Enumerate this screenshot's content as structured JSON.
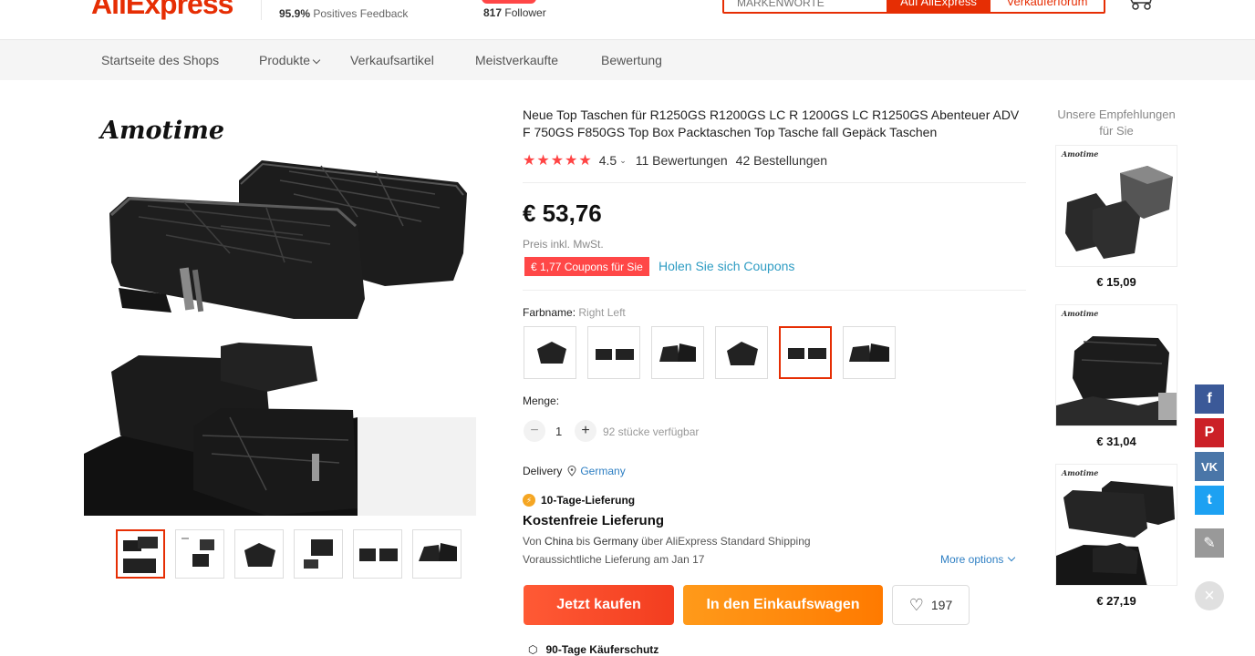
{
  "header": {
    "logo_text": "AliExpress",
    "feedback_percent": "95.9%",
    "feedback_label": "Positives Feedback",
    "followers_count": "817",
    "followers_label": "Follower",
    "search_placeholder": "MARKENWÖRTE",
    "search_all_label": "Auf AliExpress",
    "search_store_label": "Verkäuferforum"
  },
  "nav": {
    "items": [
      "Startseite des Shops",
      "Produkte",
      "Verkaufsartikel",
      "Meistverkaufte",
      "Bewertung"
    ]
  },
  "gallery": {
    "brand": "Amotime",
    "thumb_count": 6,
    "active_thumb": 0
  },
  "product": {
    "title": "Neue Top Taschen für R1250GS R1200GS LC R 1200GS LC R1250GS Abenteuer ADV F 750GS F850GS Top Box Packtaschen Top Tasche fall Gepäck Taschen",
    "stars": "★★★★★",
    "rating": "4.5",
    "rating_caret": "⌄",
    "reviews": "11 Bewertungen",
    "orders": "42 Bestellungen",
    "price": "€ 53,76",
    "vat_note": "Preis inkl. MwSt.",
    "coupon_tag": "€ 1,77 Coupons für Sie",
    "coupon_link": "Holen Sie sich Coupons",
    "color_label": "Farbname:",
    "color_value": "Right Left",
    "selected_swatch": 4,
    "quantity_label": "Menge:",
    "quantity_minus": "−",
    "quantity_plus": "+",
    "quantity_value": "1",
    "stock": "92 stücke verfügbar",
    "delivery_label": "Delivery",
    "delivery_country": "Germany",
    "ship_badge": "10-Tage-Lieferung",
    "ship_title": "Kostenfreie Lieferung",
    "ship_from_prefix": "Von ",
    "ship_from": "China",
    "ship_to_prefix": " bis ",
    "ship_to": "Germany",
    "ship_via": " über AliExpress Standard Shipping",
    "ship_estimate": "Voraussichtliche Lieferung am Jan 17",
    "more_options": "More options",
    "buy_now": "Jetzt kaufen",
    "add_to_cart": "In den Einkaufswagen",
    "wishlist_count": "197",
    "protection": "90-Tage Käuferschutz"
  },
  "recommendations": {
    "title": "Unsere Empfehlungen für Sie",
    "items": [
      {
        "price": "€ 15,09"
      },
      {
        "price": "€ 31,04"
      },
      {
        "price": "€ 27,19"
      }
    ]
  },
  "social": {
    "facebook": "f",
    "pinterest": "P",
    "vk": "VK",
    "twitter": "t",
    "edit": "✎",
    "close": "×",
    "colors": {
      "facebook": "#3b5998",
      "pinterest": "#cb2027",
      "vk": "#4a76a8",
      "twitter": "#1da1f2",
      "edit": "#999999"
    }
  },
  "colors": {
    "brand": "#e62e04",
    "coupon": "#ff4747",
    "link": "#2e9cc3",
    "buy": "#f33d1f",
    "cart": "#ff8a00"
  }
}
